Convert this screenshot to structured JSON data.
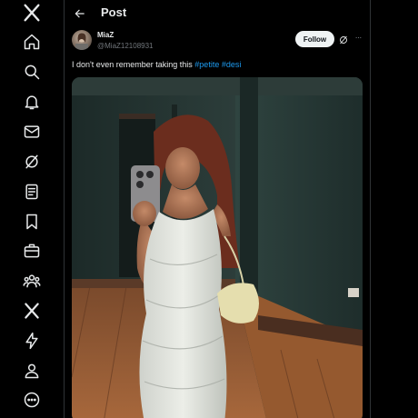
{
  "header": {
    "title": "Post"
  },
  "author": {
    "display_name": "MiaZ",
    "handle": "@MiaZ12108931"
  },
  "actions": {
    "follow_label": "Follow",
    "more_label": "···"
  },
  "tweet": {
    "text_prefix": "I don't even remember taking this ",
    "hashtags": [
      "#petite",
      "#desi"
    ]
  },
  "sidebar": {
    "items": [
      {
        "icon": "x-logo-icon"
      },
      {
        "icon": "home-icon"
      },
      {
        "icon": "search-icon"
      },
      {
        "icon": "bell-icon"
      },
      {
        "icon": "mail-icon"
      },
      {
        "icon": "grok-icon"
      },
      {
        "icon": "lists-icon"
      },
      {
        "icon": "bookmark-icon"
      },
      {
        "icon": "jobs-icon"
      },
      {
        "icon": "communities-icon"
      },
      {
        "icon": "premium-x-icon"
      },
      {
        "icon": "lightning-icon"
      },
      {
        "icon": "profile-icon"
      },
      {
        "icon": "more-circle-icon"
      }
    ]
  },
  "colors": {
    "background": "#000000",
    "accent": "#1d9bf0",
    "text": "#e7e9ea",
    "muted": "#71767b"
  }
}
